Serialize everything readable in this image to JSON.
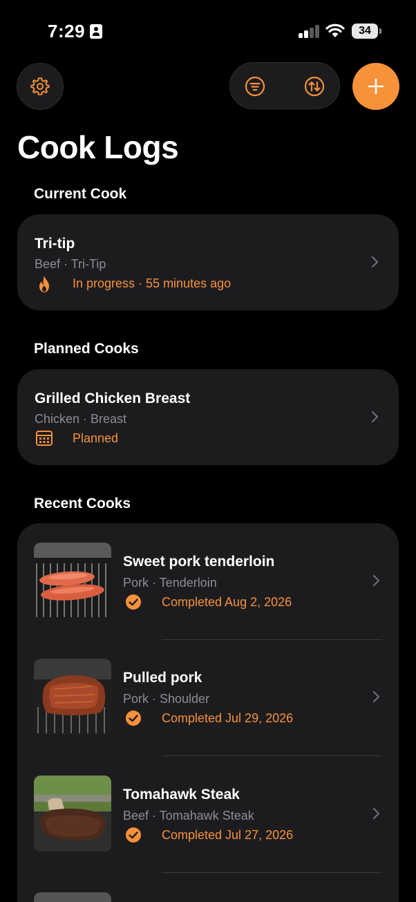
{
  "status_bar": {
    "time": "7:29",
    "battery": "34"
  },
  "colors": {
    "accent": "#f7913a",
    "card": "#1c1c1e",
    "secondary_text": "#8e8e93"
  },
  "toolbar": {
    "settings_icon": "gear-icon",
    "filter_icon": "filter-icon",
    "sort_icon": "sort-icon",
    "add_icon": "plus-icon"
  },
  "page": {
    "title": "Cook Logs"
  },
  "current": {
    "section": "Current Cook",
    "title": "Tri-tip",
    "subtitle": "Beef · Tri-Tip",
    "status": "In progress · 55 minutes ago",
    "icon": "flame-icon"
  },
  "planned": {
    "section": "Planned Cooks",
    "title": "Grilled Chicken Breast",
    "subtitle": "Chicken · Breast",
    "status": "Planned",
    "icon": "calendar-icon"
  },
  "recent": {
    "section": "Recent Cooks",
    "items": [
      {
        "title": "Sweet pork tenderloin",
        "subtitle": "Pork · Tenderloin",
        "status": "Completed Aug 2, 2026",
        "icon": "checkmark-circle-icon"
      },
      {
        "title": "Pulled pork",
        "subtitle": "Pork · Shoulder",
        "status": "Completed Jul 29, 2026",
        "icon": "checkmark-circle-icon"
      },
      {
        "title": "Tomahawk Steak",
        "subtitle": "Beef · Tomahawk Steak",
        "status": "Completed Jul 27, 2026",
        "icon": "checkmark-circle-icon"
      }
    ]
  }
}
